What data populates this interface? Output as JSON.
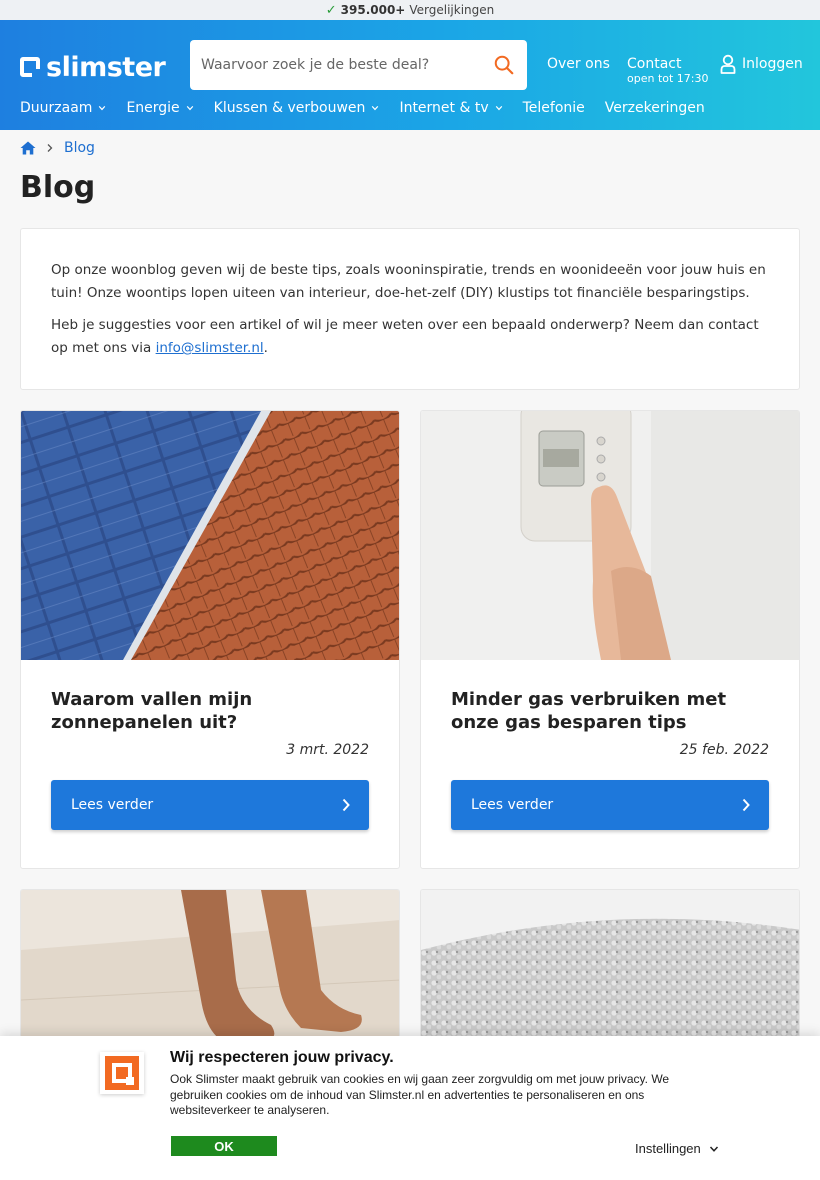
{
  "topbar": {
    "count": "395.000+",
    "label": "Vergelijkingen"
  },
  "header": {
    "logo": "slimster",
    "search_placeholder": "Waarvoor zoek je de beste deal?",
    "about": "Over ons",
    "contact": "Contact",
    "contact_hours": "open tot 17:30",
    "login": "Inloggen"
  },
  "nav": {
    "items": [
      {
        "label": "Duurzaam"
      },
      {
        "label": "Energie"
      },
      {
        "label": "Klussen & verbouwen"
      },
      {
        "label": "Internet & tv"
      },
      {
        "label": "Telefonie"
      },
      {
        "label": "Verzekeringen"
      }
    ]
  },
  "breadcrumb": {
    "current": "Blog"
  },
  "page": {
    "title": "Blog"
  },
  "intro": {
    "p1": "Op onze woonblog geven wij de beste tips, zoals wooninspiratie, trends en woonideeën voor jouw huis en tuin! Onze woontips lopen uiteen van interieur, doe-het-zelf (DIY) klustips tot financiële besparingstips.",
    "p2_before": "Heb je suggesties voor een artikel of wil je meer weten over een bepaald onderwerp? Neem dan contact op met ons via ",
    "email": "info@slimster.nl",
    "p2_after": "."
  },
  "articles": [
    {
      "title": "Waarom vallen mijn zonnepanelen uit?",
      "date": "3 mrt. 2022",
      "button": "Lees verder"
    },
    {
      "title": "Minder gas verbruiken met onze gas besparen tips",
      "date": "25 feb. 2022",
      "button": "Lees verder"
    }
  ],
  "cookie": {
    "title": "Wij respecteren jouw privacy.",
    "text": "Ook Slimster maakt gebruik van cookies en wij gaan zeer zorgvuldig om met jouw privacy. We gebruiken cookies om de inhoud van Slimster.nl en advertenties te personaliseren en ons websiteverkeer te analyseren.",
    "ok": "OK",
    "settings": "Instellingen"
  },
  "colors": {
    "brand_blue": "#1e78db",
    "accent_orange": "#f26a22",
    "ok_green": "#1e8a1e"
  }
}
